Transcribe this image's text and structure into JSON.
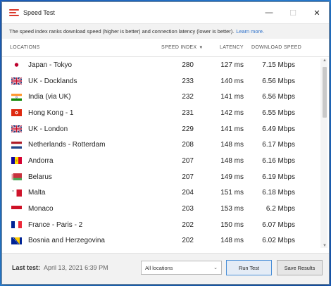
{
  "window": {
    "title": "Speed Test"
  },
  "info": {
    "text": "The speed index ranks download speed (higher is better) and connection latency (lower is better).",
    "link": "Learn more."
  },
  "columns": {
    "locations": "LOCATIONS",
    "speed_index": "SPEED INDEX",
    "latency": "LATENCY",
    "download_speed": "DOWNLOAD SPEED"
  },
  "rows": [
    {
      "location": "Japan - Tokyo",
      "flag": "japan-flag",
      "speed_index": "280",
      "latency": "127 ms",
      "download": "7.15 Mbps"
    },
    {
      "location": "UK - Docklands",
      "flag": "uk-flag",
      "speed_index": "233",
      "latency": "140 ms",
      "download": "6.56 Mbps"
    },
    {
      "location": "India (via UK)",
      "flag": "india-flag",
      "speed_index": "232",
      "latency": "141 ms",
      "download": "6.56 Mbps"
    },
    {
      "location": "Hong Kong - 1",
      "flag": "hong-kong-flag",
      "speed_index": "231",
      "latency": "142 ms",
      "download": "6.55 Mbps"
    },
    {
      "location": "UK - London",
      "flag": "uk-flag",
      "speed_index": "229",
      "latency": "141 ms",
      "download": "6.49 Mbps"
    },
    {
      "location": "Netherlands - Rotterdam",
      "flag": "netherlands-flag",
      "speed_index": "208",
      "latency": "148 ms",
      "download": "6.17 Mbps"
    },
    {
      "location": "Andorra",
      "flag": "andorra-flag",
      "speed_index": "207",
      "latency": "148 ms",
      "download": "6.16 Mbps"
    },
    {
      "location": "Belarus",
      "flag": "belarus-flag",
      "speed_index": "207",
      "latency": "149 ms",
      "download": "6.19 Mbps"
    },
    {
      "location": "Malta",
      "flag": "malta-flag",
      "speed_index": "204",
      "latency": "151 ms",
      "download": "6.18 Mbps"
    },
    {
      "location": "Monaco",
      "flag": "monaco-flag",
      "speed_index": "203",
      "latency": "153 ms",
      "download": "6.2 Mbps"
    },
    {
      "location": "France - Paris - 2",
      "flag": "france-flag",
      "speed_index": "202",
      "latency": "150 ms",
      "download": "6.07 Mbps"
    },
    {
      "location": "Bosnia and Herzegovina",
      "flag": "bosnia-flag",
      "speed_index": "202",
      "latency": "148 ms",
      "download": "6.02 Mbps"
    }
  ],
  "footer": {
    "last_test_label": "Last test:",
    "last_test_value": "April 13, 2021 6:39 PM",
    "filter_selected": "All locations",
    "run_button": "Run Test",
    "save_button": "Save Results"
  },
  "colors": {
    "accent": "#da3a2d",
    "link": "#2a6fc9",
    "desktop": "#1e64c8"
  }
}
